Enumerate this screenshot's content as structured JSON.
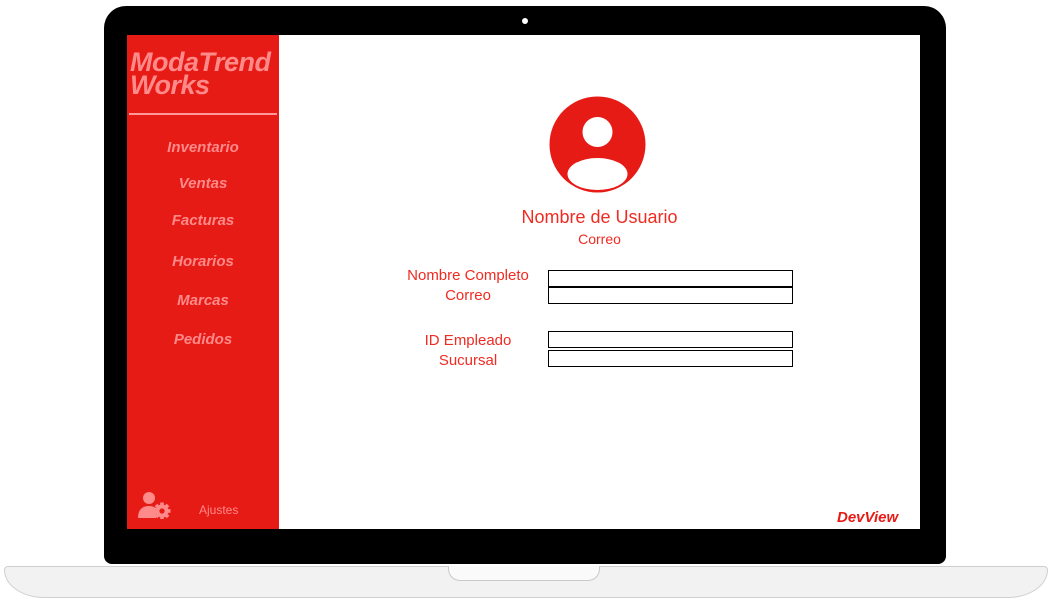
{
  "sidebar": {
    "brand": "ModaTrend Works",
    "items": [
      {
        "label": "Inventario"
      },
      {
        "label": "Ventas"
      },
      {
        "label": "Facturas"
      },
      {
        "label": "Horarios"
      },
      {
        "label": "Marcas"
      },
      {
        "label": "Pedidos"
      }
    ],
    "settings": {
      "label": "Ajustes",
      "icon": "user-gear-icon"
    }
  },
  "profile": {
    "avatar_icon": "user-avatar-icon",
    "username": "Nombre de Usuario",
    "email": "Correo"
  },
  "form": {
    "group1": {
      "label_full_name": "Nombre Completo",
      "label_email": "Correo"
    },
    "group2": {
      "label_employee_id": "ID Empleado",
      "label_branch": "Sucursal"
    }
  },
  "footer": {
    "brand": "DevView"
  },
  "colors": {
    "accent": "#e71b16",
    "text_accent": "#ef2b22",
    "sidebar_text": "#ff8a8a"
  }
}
